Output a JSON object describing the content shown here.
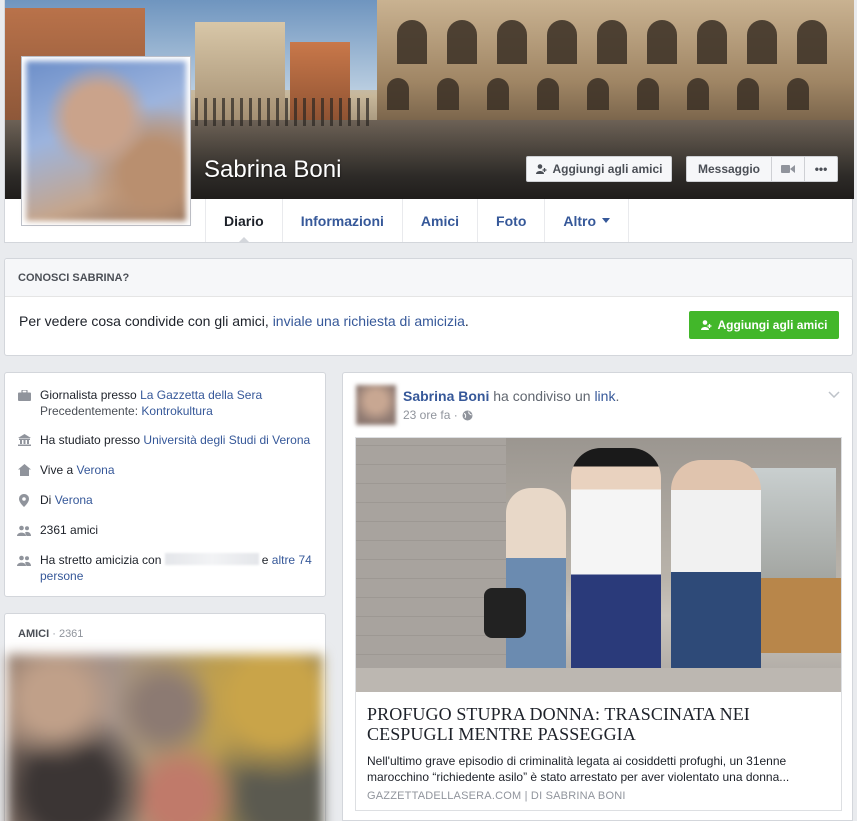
{
  "profile": {
    "name": "Sabrina Boni",
    "add_friend_label": "Aggiungi agli amici",
    "message_label": "Messaggio",
    "more_label": "•••"
  },
  "nav": {
    "tabs": [
      {
        "label": "Diario",
        "active": true
      },
      {
        "label": "Informazioni"
      },
      {
        "label": "Amici"
      },
      {
        "label": "Foto"
      },
      {
        "label": "Altro"
      }
    ]
  },
  "know": {
    "header": "CONOSCI SABRINA?",
    "text": "Per vedere cosa condivide con gli amici,",
    "link": "inviale una richiesta di amicizia",
    "suffix": ".",
    "button_label": "Aggiungi agli amici"
  },
  "intro": {
    "work_prefix": "Giornalista presso",
    "work_company": "La Gazzetta della Sera",
    "work_prev_prefix": "Precedentemente:",
    "work_prev_company": "Kontrokultura",
    "study_prefix": "Ha studiato presso",
    "study_school": "Università degli Studi di Verona",
    "lives_prefix": "Vive a",
    "lives_city": "Verona",
    "from_prefix": "Di",
    "from_city": "Verona",
    "friends_count": "2361 amici",
    "mutual_prefix": "Ha stretto amicizia con",
    "mutual_and": "e",
    "mutual_link": "altre 74 persone"
  },
  "friends": {
    "header": "AMICI",
    "count": " · 2361"
  },
  "post": {
    "author": "Sabrina Boni",
    "action": "ha condiviso un",
    "link_word": "link",
    "period": ".",
    "time": "23 ore fa ·",
    "link_title": "PROFUGO STUPRA DONNA: TRASCINATA NEI CESPUGLI MENTRE PASSEGGIA",
    "link_desc": "Nell'ultimo grave episodio di criminalità legata ai cosiddetti profughi, un 31enne marocchino “richiedente asilo” è stato arrestato per aver violentato una donna...",
    "link_source": "GAZZETTADELLASERA.COM | DI SABRINA BONI"
  },
  "colors": {
    "link_blue": "#365899",
    "green_button": "#42b72a",
    "page_bg": "#e9ebee"
  }
}
